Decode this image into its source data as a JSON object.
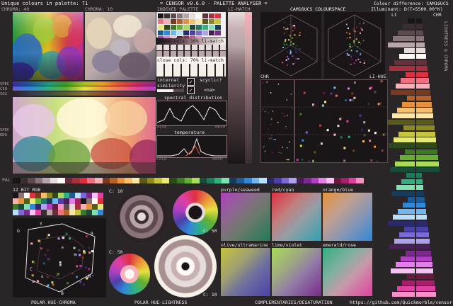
{
  "header": {
    "unique_colours": "Unique colours in palette: 71",
    "title": "= CENSOR v0.6.0 - PALETTE ANALYSER =",
    "colour_difference": "Colour difference: CAM16UCS",
    "illuminant": "Illuminant: D(T=5500.00°K)"
  },
  "labels": {
    "chroma40": "CHROMA: 40",
    "chroma10": "CHROMA: 10",
    "indexed_palette": "INDEXED PALETTE",
    "li_match": "LI-MATCH",
    "cam16ucs_colourspace": "CAM16UCS COLOURSPACE",
    "chr": "CHR",
    "li_hue": "LI-HUE",
    "li": "LI",
    "chr_right": "CHR",
    "lightness_chroma": "LIGHTNESS & CHROMA",
    "close_cols_10": "close cols: 10% li-match",
    "close_cols_70": "close cols: 70% li-match",
    "internal_similarity": "internal similarity",
    "scyclic": "scyclic?",
    "na": "<na>",
    "spectral_distribution": "spectral distribution",
    "spec_lo": "4150",
    "spec_hi": "6650",
    "temperature": "temperature",
    "cold": "COLD",
    "warm": "WARM",
    "spec": "SPEC",
    "spec_cso": "CSO",
    "spec_so": "SO2",
    "spec2": "SPEC",
    "spec2_eo": "EDO",
    "pal": "PAL",
    "bit12_rgb": "12 BIT RGB",
    "c10_a": "C: 10",
    "c50_a": "C: 50",
    "c50_b": "C: 50",
    "c10_b": "C: 10",
    "polar_hue_chroma": "POLAR HUE-CHROMA",
    "polar_hue_lightness": "POLAR HUE-LIGHTNESS",
    "complementaries": "COMPLEMENTARIES/DESATURATION",
    "url": "https://github.com/Quickmorble/censor",
    "compl_1": "purple/seaweed",
    "compl_2": "red/cyan",
    "compl_3": "orange/blue",
    "compl_4": "olive/ultramarine",
    "compl_5": "lime/violet",
    "compl_6": "emerald/rose",
    "hex_G": "G",
    "hex_Y": "Y",
    "hex_R": "R",
    "hex_M": "M",
    "hex_B": "B",
    "hex_C": "C"
  },
  "checkboxes": {
    "internal_similarity": true,
    "scyclic": true
  },
  "palette_colors": [
    "#1a1617",
    "#3a2e30",
    "#5e4a4e",
    "#8a7479",
    "#b8a6a9",
    "#e6dcdc",
    "#fff8f4",
    "#6a2e3a",
    "#a8303e",
    "#e03040",
    "#f07080",
    "#f6b0b8",
    "#7a3a1e",
    "#b8602a",
    "#e8903a",
    "#f4c070",
    "#fae6a8",
    "#5a5a1a",
    "#8c8a20",
    "#c6c43a",
    "#e6e878",
    "#2e4a1a",
    "#3e7a24",
    "#64b030",
    "#a8dc58",
    "#1a4a3a",
    "#1e7a5a",
    "#30b080",
    "#80e0b0",
    "#1a3a5a",
    "#1e5a94",
    "#3088d8",
    "#70b8f0",
    "#b8e0fa",
    "#2a2a6a",
    "#4a40a8",
    "#7a6ad8",
    "#b0a0f0",
    "#4a1e5a",
    "#7a2a8a",
    "#b040c0",
    "#e080e8",
    "#f8c0f4",
    "#6a1a40",
    "#a8206a",
    "#e040a0",
    "#f890c8"
  ]
}
